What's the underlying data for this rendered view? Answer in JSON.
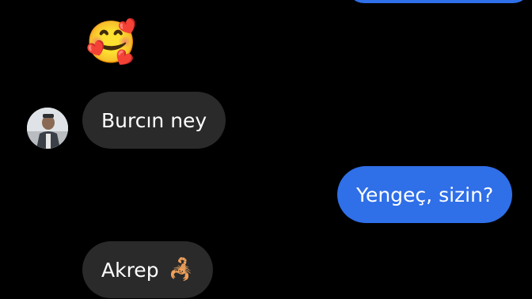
{
  "conversation": {
    "messages": [
      {
        "id": "msg-top",
        "direction": "outgoing",
        "text": ""
      },
      {
        "id": "msg-emoji",
        "direction": "incoming",
        "emoji": "🥰",
        "emoji_name": "smiling-face-with-hearts"
      },
      {
        "id": "msg-burc",
        "direction": "incoming",
        "text": "Burcın ney"
      },
      {
        "id": "msg-yengec",
        "direction": "outgoing",
        "text": "Yengeç, sizin?"
      },
      {
        "id": "msg-akrep",
        "direction": "incoming",
        "text": "Akrep",
        "emoji": "🦂",
        "emoji_name": "scorpion"
      }
    ]
  },
  "colors": {
    "background": "#000000",
    "incoming_bubble": "#2a2a2b",
    "outgoing_bubble": "#2f6fe8",
    "text": "#ffffff"
  },
  "contact": {
    "avatar_icon": "avatar-photo"
  }
}
